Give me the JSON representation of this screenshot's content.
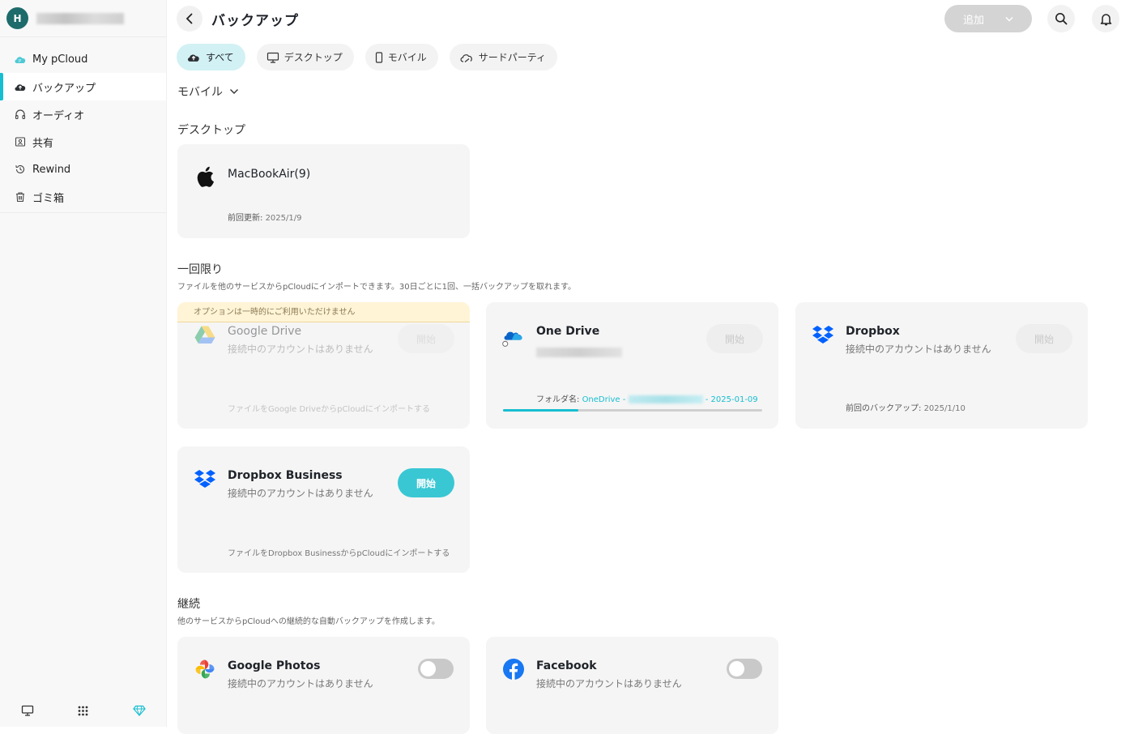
{
  "sidebar": {
    "avatar_initial": "H",
    "items": [
      {
        "label": "My pCloud",
        "icon": "pcloud-drive-icon"
      },
      {
        "label": "バックアップ",
        "icon": "cloud-backup-icon"
      },
      {
        "label": "オーディオ",
        "icon": "headphones-icon"
      },
      {
        "label": "共有",
        "icon": "shared-icon"
      },
      {
        "label": "Rewind",
        "icon": "rewind-icon"
      },
      {
        "label": "ゴミ箱",
        "icon": "trash-icon"
      }
    ]
  },
  "header": {
    "title": "バックアップ",
    "add_label": "追加"
  },
  "filters": [
    {
      "label": "すべて",
      "active": true
    },
    {
      "label": "デスクトップ"
    },
    {
      "label": "モバイル"
    },
    {
      "label": "サードパーティ"
    }
  ],
  "dropdown_label": "モバイル",
  "desktop": {
    "title": "デスクトップ",
    "card": {
      "name": "MacBookAir(9)",
      "last_label": "前回更新:",
      "last_value": "2025/1/9"
    }
  },
  "onetime": {
    "title": "一回限り",
    "description": "ファイルを他のサービスからpCloudにインポートできます。30日ごとに1回、一括バックアップを取れます。",
    "cards": {
      "gdrive": {
        "warning": "オプションは一時的にご利用いただけません",
        "name": "Google Drive",
        "sub": "接続中のアカウントはありません",
        "button": "開始",
        "foot": "ファイルをGoogle DriveからpCloudにインポートする"
      },
      "onedrive": {
        "name": "One Drive",
        "button": "開始",
        "folder_label": "フォルダ名:",
        "folder_prefix": "OneDrive -",
        "folder_date": "- 2025-01-09",
        "progress": 0.29
      },
      "dropbox": {
        "name": "Dropbox",
        "sub": "接続中のアカウントはありません",
        "button": "開始",
        "last_label": "前回のバックアップ:",
        "last_value": "2025/1/10"
      },
      "dropbox_business": {
        "name": "Dropbox Business",
        "sub": "接続中のアカウントはありません",
        "button": "開始",
        "foot": "ファイルをDropbox BusinessからpCloudにインポートする"
      }
    }
  },
  "continuous": {
    "title": "継続",
    "description": "他のサービスからpCloudへの継続的な自動バックアップを作成します。",
    "cards": {
      "gphotos": {
        "name": "Google Photos",
        "sub": "接続中のアカウントはありません",
        "enabled": false
      },
      "facebook": {
        "name": "Facebook",
        "sub": "接続中のアカウントはありません",
        "enabled": false
      }
    }
  },
  "colors": {
    "accent": "#17bed0",
    "button_on": "#39c7d4",
    "warning_bg": "#fff4d6"
  }
}
